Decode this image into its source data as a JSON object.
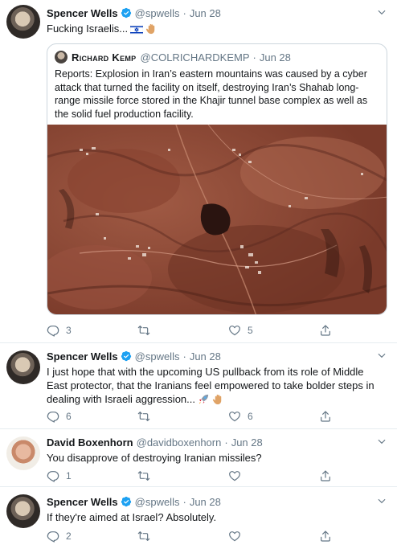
{
  "tweets": [
    {
      "name": "Spencer Wells",
      "handle": "@spwells",
      "dot": "·",
      "date": "Jun 28",
      "text": "Fucking Israelis...",
      "quote": {
        "name": "Richard Kemp",
        "handle": "@COLRICHARDKEMP",
        "dot": "·",
        "date": "Jun 28",
        "text": "Reports: Explosion in Iran’s eastern mountains was caused by a cyber attack that turned the facility on itself, destroying Iran’s Shahab long-range missile force stored in the Khajir tunnel base complex as well as the solid fuel production facility."
      },
      "replies": "3",
      "retweets": "",
      "likes": "5"
    },
    {
      "name": "Spencer Wells",
      "handle": "@spwells",
      "dot": "·",
      "date": "Jun 28",
      "text": "I just hope that with the upcoming US pullback from its role of Middle East protector, that the Iranians feel empowered to take bolder steps in dealing with Israeli aggression...",
      "replies": "6",
      "retweets": "",
      "likes": "6"
    },
    {
      "name": "David Boxenhorn",
      "handle": "@davidboxenhorn",
      "dot": "·",
      "date": "Jun 28",
      "text": "You disapprove of destroying Iranian missiles?",
      "replies": "1",
      "retweets": "",
      "likes": ""
    },
    {
      "name": "Spencer Wells",
      "handle": "@spwells",
      "dot": "·",
      "date": "Jun 28",
      "text": "If they're aimed at Israel? Absolutely.",
      "replies": "2",
      "retweets": "",
      "likes": ""
    }
  ],
  "colors": {
    "verified": "#1da1f2",
    "muted": "#657786",
    "border": "#e6ecf0"
  }
}
